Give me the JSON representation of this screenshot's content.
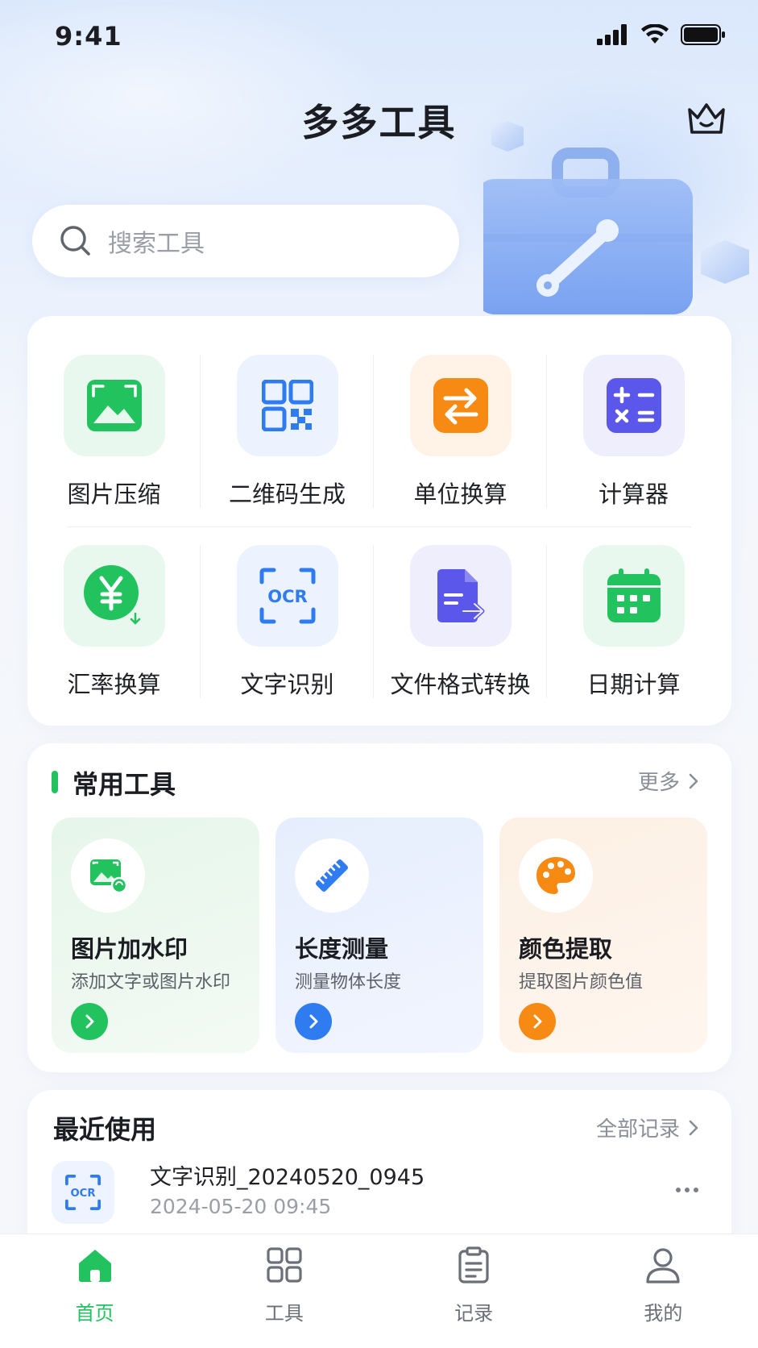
{
  "status_bar": {
    "time": "9:41"
  },
  "header": {
    "title": "多多工具"
  },
  "search": {
    "placeholder": "搜索工具"
  },
  "tool_grid": {
    "items": [
      {
        "label": "图片压缩",
        "icon": "image-compress-icon"
      },
      {
        "label": "二维码生成",
        "icon": "qr-code-icon"
      },
      {
        "label": "单位换算",
        "icon": "unit-convert-icon"
      },
      {
        "label": "计算器",
        "icon": "calculator-icon"
      },
      {
        "label": "汇率换算",
        "icon": "currency-yen-icon"
      },
      {
        "label": "文字识别",
        "icon": "ocr-icon",
        "icon_text": "OCR"
      },
      {
        "label": "文件格式转换",
        "icon": "file-convert-icon"
      },
      {
        "label": "日期计算",
        "icon": "calendar-icon"
      }
    ]
  },
  "common_tools": {
    "title": "常用工具",
    "more": "更多",
    "items": [
      {
        "title": "图片加水印",
        "desc": "添加文字或图片水印",
        "icon": "image-watermark-icon",
        "accent": "#22c35e"
      },
      {
        "title": "长度测量",
        "desc": "测量物体长度",
        "icon": "ruler-icon",
        "accent": "#2f7bf0"
      },
      {
        "title": "颜色提取",
        "desc": "提取图片颜色值",
        "icon": "palette-icon",
        "accent": "#f78a12"
      }
    ]
  },
  "recent": {
    "title": "最近使用",
    "more": "全部记录",
    "items": [
      {
        "name": "文字识别_20240520_0945",
        "time": "2024-05-20 09:45",
        "icon": "ocr-icon",
        "icon_text": "OCR"
      }
    ]
  },
  "tabbar": {
    "tabs": [
      {
        "label": "首页",
        "icon": "home-icon",
        "active": true
      },
      {
        "label": "工具",
        "icon": "grid-icon",
        "active": false
      },
      {
        "label": "记录",
        "icon": "clipboard-icon",
        "active": false
      },
      {
        "label": "我的",
        "icon": "user-icon",
        "active": false
      }
    ]
  },
  "colors": {
    "brand_green": "#22c35e",
    "blue": "#2f7bf0",
    "orange": "#f78a12",
    "purple": "#5b57ea"
  }
}
